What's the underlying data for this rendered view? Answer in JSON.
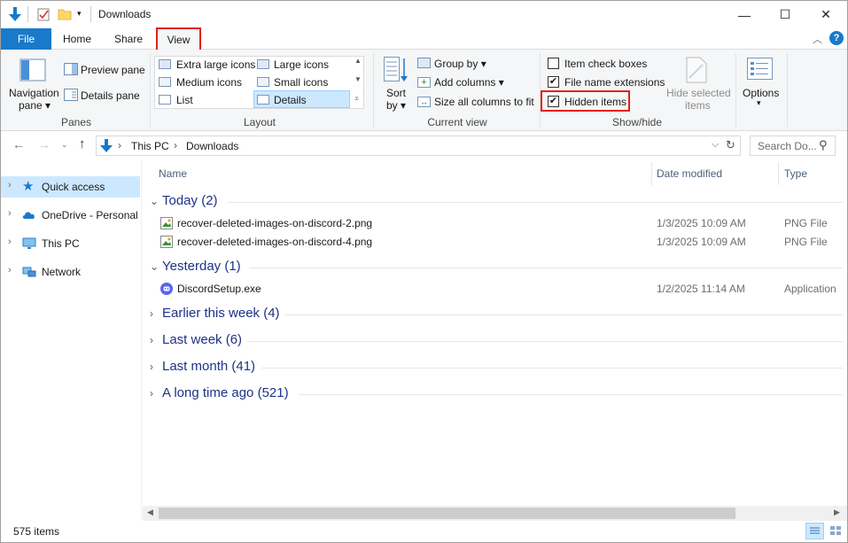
{
  "window": {
    "title": "Downloads"
  },
  "caption": {
    "minimize": "—",
    "maximize": "☐",
    "close": "✕"
  },
  "tabs": {
    "file": "File",
    "home": "Home",
    "share": "Share",
    "view": "View"
  },
  "ribbon": {
    "panes": {
      "label": "Panes",
      "navigation_pane_line1": "Navigation",
      "navigation_pane_line2": "pane ▾",
      "preview_pane": "Preview pane",
      "details_pane": "Details pane"
    },
    "layout": {
      "label": "Layout",
      "options": [
        "Extra large icons",
        "Large icons",
        "Medium icons",
        "Small icons",
        "List",
        "Details"
      ],
      "selected": "Details"
    },
    "current_view": {
      "label": "Current view",
      "sort_line1": "Sort",
      "sort_line2": "by ▾",
      "group_by": "Group by ▾",
      "add_columns": "Add columns ▾",
      "size_columns": "Size all columns to fit"
    },
    "show_hide": {
      "label": "Show/hide",
      "item_check_boxes": {
        "label": "Item check boxes",
        "checked": false
      },
      "file_name_extensions": {
        "label": "File name extensions",
        "checked": true
      },
      "hidden_items": {
        "label": "Hidden items",
        "checked": true
      },
      "hide_selected_line1": "Hide selected",
      "hide_selected_line2": "items"
    },
    "options": {
      "label": "Options",
      "chevron": "▾"
    }
  },
  "address": {
    "crumbs": [
      "This PC",
      "Downloads"
    ],
    "separator": "›",
    "search_placeholder": "Search Do..."
  },
  "nav": {
    "items": [
      {
        "label": "Quick access",
        "icon": "star-icon",
        "selected": true
      },
      {
        "label": "OneDrive - Personal",
        "icon": "cloud-icon",
        "selected": false
      },
      {
        "label": "This PC",
        "icon": "monitor-icon",
        "selected": false
      },
      {
        "label": "Network",
        "icon": "network-icon",
        "selected": false
      }
    ]
  },
  "columns": {
    "name": "Name",
    "date_modified": "Date modified",
    "type": "Type"
  },
  "groups": [
    {
      "label": "Today (2)",
      "expanded": true
    },
    {
      "label": "Yesterday (1)",
      "expanded": true
    },
    {
      "label": "Earlier this week (4)",
      "expanded": false
    },
    {
      "label": "Last week (6)",
      "expanded": false
    },
    {
      "label": "Last month (41)",
      "expanded": false
    },
    {
      "label": "A long time ago (521)",
      "expanded": false
    }
  ],
  "files": [
    {
      "name": "recover-deleted-images-on-discord-2.png",
      "date": "1/3/2025 10:09 AM",
      "type": "PNG File",
      "icon": "image-file-icon"
    },
    {
      "name": "recover-deleted-images-on-discord-4.png",
      "date": "1/3/2025 10:09 AM",
      "type": "PNG File",
      "icon": "image-file-icon"
    },
    {
      "name": "DiscordSetup.exe",
      "date": "1/2/2025 11:14 AM",
      "type": "Application",
      "icon": "discord-icon"
    }
  ],
  "status": {
    "count": "575 items"
  },
  "colors": {
    "accent": "#1979ca",
    "highlight_red": "#e3201b",
    "selection": "#cce8ff",
    "group_text": "#1e3287"
  }
}
